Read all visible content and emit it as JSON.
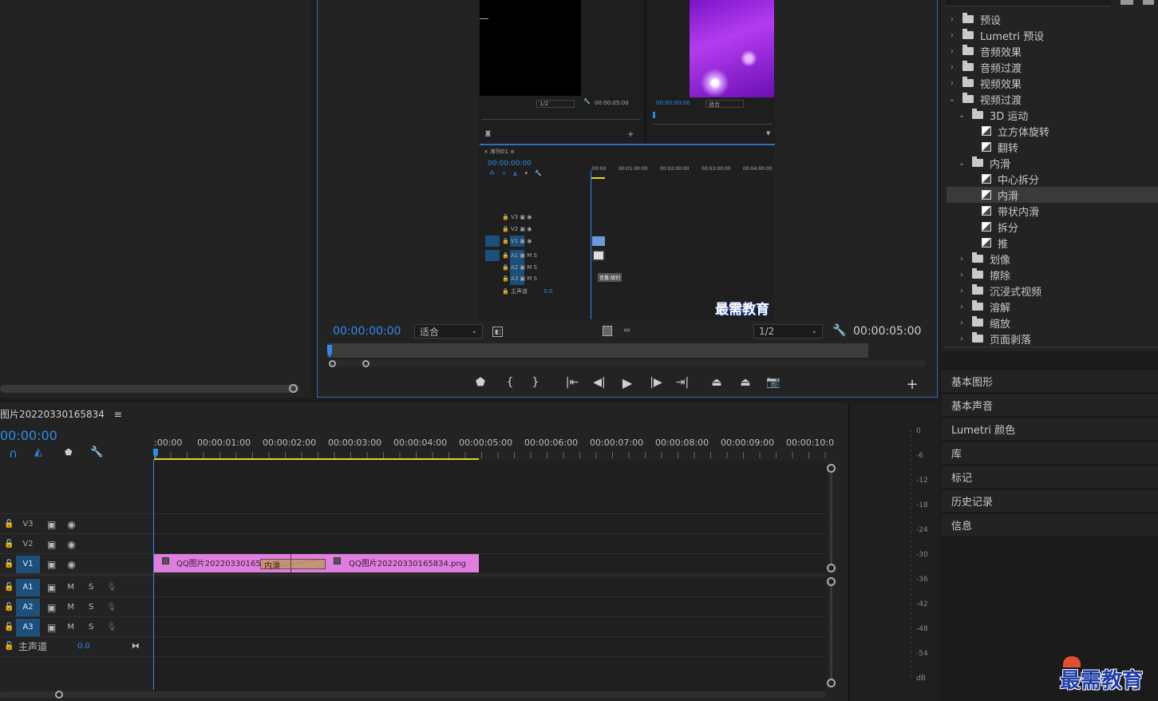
{
  "program_monitor": {
    "timecode": "00:00:00:00",
    "fit": "适合",
    "resolution": "1/2",
    "duration": "00:00:05:00",
    "watermark": "最需教育"
  },
  "inner_source": {
    "resolution": "1/2",
    "duration": "00:00:05:00"
  },
  "inner_program": {
    "timecode": "00:00:00:00",
    "fit": "适合"
  },
  "inner_timeline": {
    "title": "序列01",
    "timecode": "00:00:00:00",
    "ruler": [
      ":00:00",
      "00:01:00:00",
      "00:02:00:00",
      "00:03:00:00",
      "00:04:00:00"
    ],
    "tracks": [
      "V3",
      "V2",
      "V1",
      "A1",
      "A2",
      "A3"
    ],
    "master": "主声道",
    "master_value": "0.0",
    "tooltip": "音量:级别"
  },
  "effects_tree": [
    {
      "label": "预设",
      "level": 0,
      "type": "folder",
      "open": false
    },
    {
      "label": "Lumetri 预设",
      "level": 0,
      "type": "folder",
      "open": false
    },
    {
      "label": "音频效果",
      "level": 0,
      "type": "folder",
      "open": false
    },
    {
      "label": "音频过渡",
      "level": 0,
      "type": "folder",
      "open": false
    },
    {
      "label": "视频效果",
      "level": 0,
      "type": "folder",
      "open": false
    },
    {
      "label": "视频过渡",
      "level": 0,
      "type": "folder",
      "open": true
    },
    {
      "label": "3D 运动",
      "level": 1,
      "type": "folder",
      "open": true
    },
    {
      "label": "立方体旋转",
      "level": 2,
      "type": "fx"
    },
    {
      "label": "翻转",
      "level": 2,
      "type": "fx"
    },
    {
      "label": "内滑",
      "level": 1,
      "type": "folder",
      "open": true
    },
    {
      "label": "中心拆分",
      "level": 2,
      "type": "fx"
    },
    {
      "label": "内滑",
      "level": 2,
      "type": "fx",
      "selected": true
    },
    {
      "label": "带状内滑",
      "level": 2,
      "type": "fx"
    },
    {
      "label": "拆分",
      "level": 2,
      "type": "fx"
    },
    {
      "label": "推",
      "level": 2,
      "type": "fx"
    },
    {
      "label": "划像",
      "level": 1,
      "type": "folder",
      "open": false
    },
    {
      "label": "擦除",
      "level": 1,
      "type": "folder",
      "open": false
    },
    {
      "label": "沉浸式视频",
      "level": 1,
      "type": "folder",
      "open": false
    },
    {
      "label": "溶解",
      "level": 1,
      "type": "folder",
      "open": false
    },
    {
      "label": "缩放",
      "level": 1,
      "type": "folder",
      "open": false
    },
    {
      "label": "页面剥落",
      "level": 1,
      "type": "folder",
      "open": false
    }
  ],
  "workspace_panels": [
    "基本图形",
    "基本声音",
    "Lumetri 颜色",
    "库",
    "标记",
    "历史记录",
    "信息"
  ],
  "timeline": {
    "title": "图片20220330165834",
    "timecode": "00:00:00",
    "ruler": [
      ":00:00",
      "00:00:01:00",
      "00:00:02:00",
      "00:00:03:00",
      "00:00:04:00",
      "00:00:05:00",
      "00:00:06:00",
      "00:00:07:00",
      "00:00:08:00",
      "00:00:09:00",
      "00:00:10:0"
    ],
    "video_tracks": [
      "V3",
      "V2",
      "V1"
    ],
    "audio_tracks": [
      "A1",
      "A2",
      "A3"
    ],
    "mute": "M",
    "solo": "S",
    "master_label": "主声道",
    "master_value": "0.0",
    "clip_a": "QQ图片2022033016583",
    "transition": "内滑",
    "clip_b": "QQ图片20220330165834.png"
  },
  "audio_meter": [
    "0",
    "-6",
    "-12",
    "-18",
    "-24",
    "-30",
    "-36",
    "-42",
    "-48",
    "-54",
    "dB"
  ],
  "watermark_logo": "最需教育",
  "colors": {
    "accent": "#2d8ceb",
    "clip": "#e07ee0",
    "track_on": "#1c4f7a",
    "playhead_region": "#d8d82a"
  }
}
